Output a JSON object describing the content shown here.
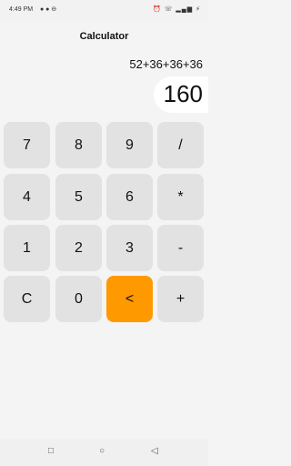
{
  "status_bar": {
    "time": "4:49 PM",
    "left_icons": "● ● ⊖",
    "right_icons": "⏰ ☏ ▂▄▆ ⚡"
  },
  "app": {
    "title": "Calculator"
  },
  "display": {
    "expression": "52+36+36+36",
    "result": "160"
  },
  "keypad": {
    "rows": [
      [
        "7",
        "8",
        "9",
        "/"
      ],
      [
        "4",
        "5",
        "6",
        "*"
      ],
      [
        "1",
        "2",
        "3",
        "-"
      ],
      [
        "C",
        "0",
        "<",
        "+"
      ]
    ],
    "accent_color": "#ff9900",
    "key_color": "#e2e2e2"
  },
  "nav_bar": {
    "recents_icon": "□",
    "home_icon": "○",
    "back_icon": "◁"
  }
}
